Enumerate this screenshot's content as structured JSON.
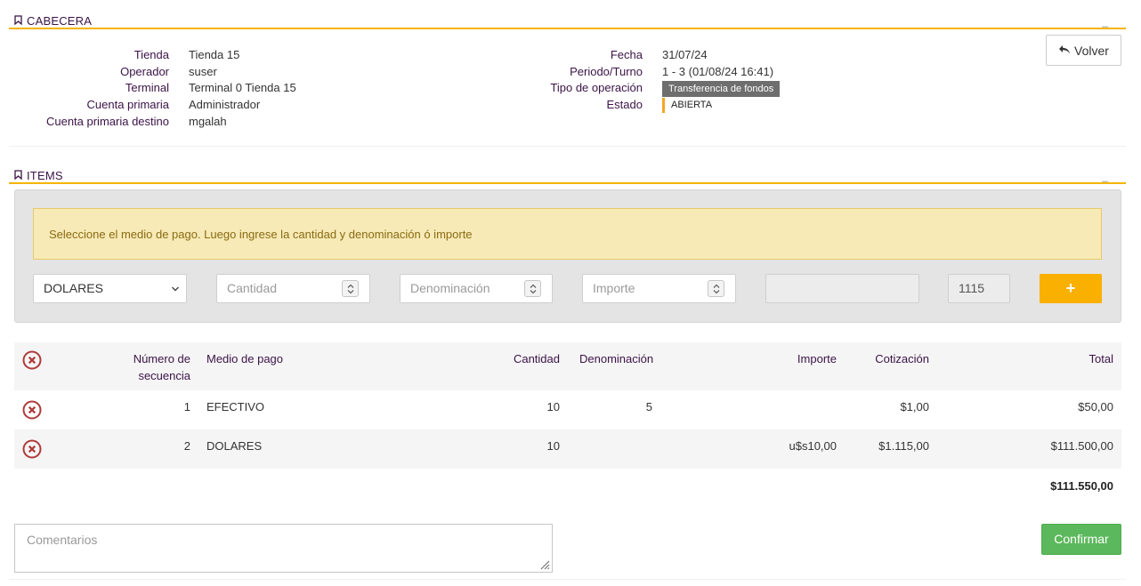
{
  "cabecera": {
    "title": "CABECERA",
    "collapse": "_",
    "back_label": "Volver",
    "left": [
      {
        "label": "Tienda",
        "value": "Tienda 15"
      },
      {
        "label": "Operador",
        "value": "suser"
      },
      {
        "label": "Terminal",
        "value": "Terminal 0 Tienda 15"
      },
      {
        "label": "Cuenta primaria",
        "value": "Administrador"
      },
      {
        "label": "Cuenta primaria destino",
        "value": "mgalah"
      }
    ],
    "right": {
      "fecha_label": "Fecha",
      "fecha": "31/07/24",
      "periodo_label": "Periodo/Turno",
      "periodo": "1 - 3 (01/08/24 16:41)",
      "tipo_label": "Tipo de operación",
      "tipo": "Transferencia de fondos",
      "estado_label": "Estado",
      "estado": "ABIERTA"
    }
  },
  "items": {
    "title": "ITEMS",
    "collapse": "_",
    "alert": "Seleccione el medio de pago. Luego ingrese la cantidad y denominación ó importe",
    "form": {
      "medio_pago": "DOLARES",
      "cantidad_placeholder": "Cantidad",
      "denominacion_placeholder": "Denominación",
      "importe_placeholder": "Importe",
      "extra": "",
      "cotizacion": "1115",
      "add_label": "+"
    },
    "columns": {
      "numero_1": "Número de",
      "numero_2": "secuencia",
      "medio": "Medio de pago",
      "cantidad": "Cantidad",
      "denominacion": "Denominación",
      "importe": "Importe",
      "cotizacion": "Cotización",
      "total": "Total"
    },
    "rows": [
      {
        "numero": "1",
        "medio": "EFECTIVO",
        "cantidad": "10",
        "denominacion": "5",
        "importe": "",
        "cotizacion": "$1,00",
        "total": "$50,00"
      },
      {
        "numero": "2",
        "medio": "DOLARES",
        "cantidad": "10",
        "denominacion": "",
        "importe": "u$s10,00",
        "cotizacion": "$1.115,00",
        "total": "$111.500,00"
      }
    ],
    "grand_total": "$111.550,00",
    "comentarios_placeholder": "Comentarios",
    "confirmar_label": "Confirmar"
  },
  "colors": {
    "accent": "#f5b400",
    "label": "#3b1347",
    "confirm": "#5cb85c",
    "delete": "#b03a3a"
  }
}
